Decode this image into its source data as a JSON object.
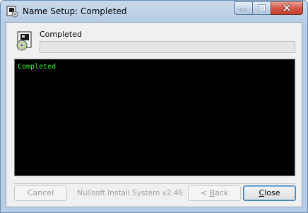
{
  "window": {
    "title": "Name Setup: Completed"
  },
  "header": {
    "status": "Completed",
    "progress_percent": 0
  },
  "log": {
    "lines": [
      "Completed"
    ]
  },
  "footer": {
    "brand": "Nullsoft Install System v2.46",
    "cancel_label": "Cancel",
    "back_label_prefix": "< ",
    "back_label_mnemonic": "B",
    "back_label_rest": "ack",
    "close_label_mnemonic": "C",
    "close_label_rest": "lose"
  },
  "colors": {
    "log_text": "#2bf22b",
    "log_background": "#000000"
  },
  "icons": {
    "title": "installer-icon",
    "setup": "setup-box-cd-icon"
  }
}
